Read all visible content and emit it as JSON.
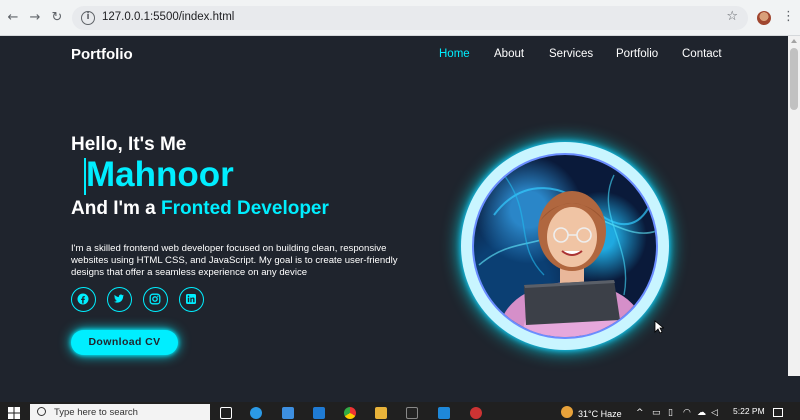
{
  "browser": {
    "url": "127.0.0.1:5500/index.html",
    "icons": [
      "back-icon",
      "forward-icon",
      "reload-icon",
      "info-icon",
      "star-icon",
      "menu-icon"
    ]
  },
  "site": {
    "logo": "Portfolio",
    "nav": [
      {
        "label": "Home",
        "active": true
      },
      {
        "label": "About",
        "active": false
      },
      {
        "label": "Services",
        "active": false
      },
      {
        "label": "Portfolio",
        "active": false
      },
      {
        "label": "Contact",
        "active": false
      }
    ]
  },
  "hero": {
    "greeting": "Hello, It's Me",
    "name": "Mahnoor",
    "role_prefix": "And I'm a",
    "role": "Fronted Developer",
    "description": "I'm a skilled frontend web developer focused on building clean, responsive websites using HTML CSS, and JavaScript. My goal is to create user-friendly designs that offer a seamless experience on any device",
    "socials": [
      "facebook-icon",
      "twitter-icon",
      "instagram-icon",
      "linkedin-icon"
    ],
    "download_label": "Download CV"
  },
  "taskbar": {
    "search_placeholder": "Type here to search",
    "temperature": "31°C",
    "weather": "Haze",
    "time": "5:22 PM"
  },
  "colors": {
    "accent": "#00eeff",
    "background": "#1f242d",
    "text": "#ffffff"
  }
}
